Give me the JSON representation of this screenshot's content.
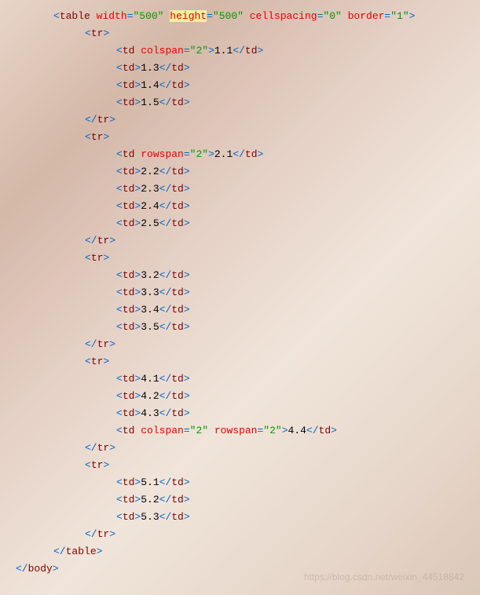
{
  "code": {
    "lines": [
      {
        "indent": 1,
        "parts": [
          {
            "type": "bracket",
            "text": "<"
          },
          {
            "type": "tagname",
            "text": "table"
          },
          {
            "type": "plain",
            "text": " "
          },
          {
            "type": "attrname",
            "text": "width"
          },
          {
            "type": "bracket",
            "text": "="
          },
          {
            "type": "attrvalue",
            "text": "\"500\""
          },
          {
            "type": "plain",
            "text": " "
          },
          {
            "type": "attrname",
            "text": "height",
            "highlight": true
          },
          {
            "type": "bracket",
            "text": "="
          },
          {
            "type": "attrvalue",
            "text": "\"500\""
          },
          {
            "type": "plain",
            "text": " "
          },
          {
            "type": "attrname",
            "text": "cellspacing"
          },
          {
            "type": "bracket",
            "text": "="
          },
          {
            "type": "attrvalue",
            "text": "\"0\""
          },
          {
            "type": "plain",
            "text": " "
          },
          {
            "type": "attrname",
            "text": "border"
          },
          {
            "type": "bracket",
            "text": "="
          },
          {
            "type": "attrvalue",
            "text": "\"1\""
          },
          {
            "type": "bracket",
            "text": ">"
          }
        ]
      },
      {
        "indent": 2,
        "parts": [
          {
            "type": "bracket",
            "text": "<"
          },
          {
            "type": "tagname",
            "text": "tr"
          },
          {
            "type": "bracket",
            "text": ">"
          }
        ]
      },
      {
        "indent": 3,
        "parts": [
          {
            "type": "bracket",
            "text": "<"
          },
          {
            "type": "tagname",
            "text": "td"
          },
          {
            "type": "plain",
            "text": " "
          },
          {
            "type": "attrname",
            "text": "colspan"
          },
          {
            "type": "bracket",
            "text": "="
          },
          {
            "type": "attrvalue",
            "text": "\"2\""
          },
          {
            "type": "bracket",
            "text": ">"
          },
          {
            "type": "content",
            "text": "1.1"
          },
          {
            "type": "bracket",
            "text": "</"
          },
          {
            "type": "tagname",
            "text": "td"
          },
          {
            "type": "bracket",
            "text": ">"
          }
        ]
      },
      {
        "indent": 3,
        "parts": [
          {
            "type": "bracket",
            "text": "<"
          },
          {
            "type": "tagname",
            "text": "td"
          },
          {
            "type": "bracket",
            "text": ">"
          },
          {
            "type": "content",
            "text": "1.3"
          },
          {
            "type": "bracket",
            "text": "</"
          },
          {
            "type": "tagname",
            "text": "td"
          },
          {
            "type": "bracket",
            "text": ">"
          }
        ]
      },
      {
        "indent": 3,
        "parts": [
          {
            "type": "bracket",
            "text": "<"
          },
          {
            "type": "tagname",
            "text": "td"
          },
          {
            "type": "bracket",
            "text": ">"
          },
          {
            "type": "content",
            "text": "1.4"
          },
          {
            "type": "bracket",
            "text": "</"
          },
          {
            "type": "tagname",
            "text": "td"
          },
          {
            "type": "bracket",
            "text": ">"
          }
        ]
      },
      {
        "indent": 3,
        "parts": [
          {
            "type": "bracket",
            "text": "<"
          },
          {
            "type": "tagname",
            "text": "td"
          },
          {
            "type": "bracket",
            "text": ">"
          },
          {
            "type": "content",
            "text": "1.5"
          },
          {
            "type": "bracket",
            "text": "</"
          },
          {
            "type": "tagname",
            "text": "td"
          },
          {
            "type": "bracket",
            "text": ">"
          }
        ]
      },
      {
        "indent": 2,
        "parts": [
          {
            "type": "bracket",
            "text": "</"
          },
          {
            "type": "tagname",
            "text": "tr"
          },
          {
            "type": "bracket",
            "text": ">"
          }
        ]
      },
      {
        "indent": 2,
        "parts": [
          {
            "type": "bracket",
            "text": "<"
          },
          {
            "type": "tagname",
            "text": "tr"
          },
          {
            "type": "bracket",
            "text": ">"
          }
        ]
      },
      {
        "indent": 3,
        "parts": [
          {
            "type": "bracket",
            "text": "<"
          },
          {
            "type": "tagname",
            "text": "td"
          },
          {
            "type": "plain",
            "text": " "
          },
          {
            "type": "attrname",
            "text": "rowspan"
          },
          {
            "type": "bracket",
            "text": "="
          },
          {
            "type": "attrvalue",
            "text": "\"2\""
          },
          {
            "type": "bracket",
            "text": ">"
          },
          {
            "type": "content",
            "text": "2.1"
          },
          {
            "type": "bracket",
            "text": "</"
          },
          {
            "type": "tagname",
            "text": "td"
          },
          {
            "type": "bracket",
            "text": ">"
          }
        ]
      },
      {
        "indent": 3,
        "parts": [
          {
            "type": "bracket",
            "text": "<"
          },
          {
            "type": "tagname",
            "text": "td"
          },
          {
            "type": "bracket",
            "text": ">"
          },
          {
            "type": "content",
            "text": "2.2"
          },
          {
            "type": "bracket",
            "text": "</"
          },
          {
            "type": "tagname",
            "text": "td"
          },
          {
            "type": "bracket",
            "text": ">"
          }
        ]
      },
      {
        "indent": 3,
        "parts": [
          {
            "type": "bracket",
            "text": "<"
          },
          {
            "type": "tagname",
            "text": "td"
          },
          {
            "type": "bracket",
            "text": ">"
          },
          {
            "type": "content",
            "text": "2.3"
          },
          {
            "type": "bracket",
            "text": "</"
          },
          {
            "type": "tagname",
            "text": "td"
          },
          {
            "type": "bracket",
            "text": ">"
          }
        ]
      },
      {
        "indent": 3,
        "parts": [
          {
            "type": "bracket",
            "text": "<"
          },
          {
            "type": "tagname",
            "text": "td"
          },
          {
            "type": "bracket",
            "text": ">"
          },
          {
            "type": "content",
            "text": "2.4"
          },
          {
            "type": "bracket",
            "text": "</"
          },
          {
            "type": "tagname",
            "text": "td"
          },
          {
            "type": "bracket",
            "text": ">"
          }
        ]
      },
      {
        "indent": 3,
        "parts": [
          {
            "type": "bracket",
            "text": "<"
          },
          {
            "type": "tagname",
            "text": "td"
          },
          {
            "type": "bracket",
            "text": ">"
          },
          {
            "type": "content",
            "text": "2.5"
          },
          {
            "type": "bracket",
            "text": "</"
          },
          {
            "type": "tagname",
            "text": "td"
          },
          {
            "type": "bracket",
            "text": ">"
          }
        ]
      },
      {
        "indent": 2,
        "parts": [
          {
            "type": "bracket",
            "text": "</"
          },
          {
            "type": "tagname",
            "text": "tr"
          },
          {
            "type": "bracket",
            "text": ">"
          }
        ]
      },
      {
        "indent": 2,
        "parts": [
          {
            "type": "bracket",
            "text": "<"
          },
          {
            "type": "tagname",
            "text": "tr"
          },
          {
            "type": "bracket",
            "text": ">"
          }
        ]
      },
      {
        "indent": 3,
        "parts": [
          {
            "type": "bracket",
            "text": "<"
          },
          {
            "type": "tagname",
            "text": "td"
          },
          {
            "type": "bracket",
            "text": ">"
          },
          {
            "type": "content",
            "text": "3.2"
          },
          {
            "type": "bracket",
            "text": "</"
          },
          {
            "type": "tagname",
            "text": "td"
          },
          {
            "type": "bracket",
            "text": ">"
          }
        ]
      },
      {
        "indent": 3,
        "parts": [
          {
            "type": "bracket",
            "text": "<"
          },
          {
            "type": "tagname",
            "text": "td"
          },
          {
            "type": "bracket",
            "text": ">"
          },
          {
            "type": "content",
            "text": "3.3"
          },
          {
            "type": "bracket",
            "text": "</"
          },
          {
            "type": "tagname",
            "text": "td"
          },
          {
            "type": "bracket",
            "text": ">"
          }
        ]
      },
      {
        "indent": 3,
        "parts": [
          {
            "type": "bracket",
            "text": "<"
          },
          {
            "type": "tagname",
            "text": "td"
          },
          {
            "type": "bracket",
            "text": ">"
          },
          {
            "type": "content",
            "text": "3.4"
          },
          {
            "type": "bracket",
            "text": "</"
          },
          {
            "type": "tagname",
            "text": "td"
          },
          {
            "type": "bracket",
            "text": ">"
          }
        ]
      },
      {
        "indent": 3,
        "parts": [
          {
            "type": "bracket",
            "text": "<"
          },
          {
            "type": "tagname",
            "text": "td"
          },
          {
            "type": "bracket",
            "text": ">"
          },
          {
            "type": "content",
            "text": "3.5"
          },
          {
            "type": "bracket",
            "text": "</"
          },
          {
            "type": "tagname",
            "text": "td"
          },
          {
            "type": "bracket",
            "text": ">"
          }
        ]
      },
      {
        "indent": 2,
        "parts": [
          {
            "type": "bracket",
            "text": "</"
          },
          {
            "type": "tagname",
            "text": "tr"
          },
          {
            "type": "bracket",
            "text": ">"
          }
        ]
      },
      {
        "indent": 2,
        "parts": [
          {
            "type": "bracket",
            "text": "<"
          },
          {
            "type": "tagname",
            "text": "tr"
          },
          {
            "type": "bracket",
            "text": ">"
          }
        ]
      },
      {
        "indent": 3,
        "parts": [
          {
            "type": "bracket",
            "text": "<"
          },
          {
            "type": "tagname",
            "text": "td"
          },
          {
            "type": "bracket",
            "text": ">"
          },
          {
            "type": "content",
            "text": "4.1"
          },
          {
            "type": "bracket",
            "text": "</"
          },
          {
            "type": "tagname",
            "text": "td"
          },
          {
            "type": "bracket",
            "text": ">"
          }
        ]
      },
      {
        "indent": 3,
        "parts": [
          {
            "type": "bracket",
            "text": "<"
          },
          {
            "type": "tagname",
            "text": "td"
          },
          {
            "type": "bracket",
            "text": ">"
          },
          {
            "type": "content",
            "text": "4.2"
          },
          {
            "type": "bracket",
            "text": "</"
          },
          {
            "type": "tagname",
            "text": "td"
          },
          {
            "type": "bracket",
            "text": ">"
          }
        ]
      },
      {
        "indent": 3,
        "parts": [
          {
            "type": "bracket",
            "text": "<"
          },
          {
            "type": "tagname",
            "text": "td"
          },
          {
            "type": "bracket",
            "text": ">"
          },
          {
            "type": "content",
            "text": "4.3"
          },
          {
            "type": "bracket",
            "text": "</"
          },
          {
            "type": "tagname",
            "text": "td"
          },
          {
            "type": "bracket",
            "text": ">"
          }
        ]
      },
      {
        "indent": 3,
        "parts": [
          {
            "type": "bracket",
            "text": "<"
          },
          {
            "type": "tagname",
            "text": "td"
          },
          {
            "type": "plain",
            "text": " "
          },
          {
            "type": "attrname",
            "text": "colspan"
          },
          {
            "type": "bracket",
            "text": "="
          },
          {
            "type": "attrvalue",
            "text": "\"2\""
          },
          {
            "type": "plain",
            "text": " "
          },
          {
            "type": "attrname",
            "text": "rowspan"
          },
          {
            "type": "bracket",
            "text": "="
          },
          {
            "type": "attrvalue",
            "text": "\"2\""
          },
          {
            "type": "bracket",
            "text": ">"
          },
          {
            "type": "content",
            "text": "4.4"
          },
          {
            "type": "bracket",
            "text": "</"
          },
          {
            "type": "tagname",
            "text": "td"
          },
          {
            "type": "bracket",
            "text": ">"
          }
        ]
      },
      {
        "indent": 2,
        "parts": [
          {
            "type": "bracket",
            "text": "</"
          },
          {
            "type": "tagname",
            "text": "tr"
          },
          {
            "type": "bracket",
            "text": ">"
          }
        ]
      },
      {
        "indent": 2,
        "parts": [
          {
            "type": "bracket",
            "text": "<"
          },
          {
            "type": "tagname",
            "text": "tr"
          },
          {
            "type": "bracket",
            "text": ">"
          }
        ]
      },
      {
        "indent": 3,
        "parts": [
          {
            "type": "bracket",
            "text": "<"
          },
          {
            "type": "tagname",
            "text": "td"
          },
          {
            "type": "bracket",
            "text": ">"
          },
          {
            "type": "content",
            "text": "5.1"
          },
          {
            "type": "bracket",
            "text": "</"
          },
          {
            "type": "tagname",
            "text": "td"
          },
          {
            "type": "bracket",
            "text": ">"
          }
        ]
      },
      {
        "indent": 3,
        "parts": [
          {
            "type": "bracket",
            "text": "<"
          },
          {
            "type": "tagname",
            "text": "td"
          },
          {
            "type": "bracket",
            "text": ">"
          },
          {
            "type": "content",
            "text": "5.2"
          },
          {
            "type": "bracket",
            "text": "</"
          },
          {
            "type": "tagname",
            "text": "td"
          },
          {
            "type": "bracket",
            "text": ">"
          }
        ]
      },
      {
        "indent": 3,
        "parts": [
          {
            "type": "bracket",
            "text": "<"
          },
          {
            "type": "tagname",
            "text": "td"
          },
          {
            "type": "bracket",
            "text": ">"
          },
          {
            "type": "content",
            "text": "5.3"
          },
          {
            "type": "bracket",
            "text": "</"
          },
          {
            "type": "tagname",
            "text": "td"
          },
          {
            "type": "bracket",
            "text": ">"
          }
        ]
      },
      {
        "indent": 2,
        "parts": [
          {
            "type": "bracket",
            "text": "</"
          },
          {
            "type": "tagname",
            "text": "tr"
          },
          {
            "type": "bracket",
            "text": ">"
          }
        ]
      },
      {
        "indent": 1,
        "parts": [
          {
            "type": "bracket",
            "text": "</"
          },
          {
            "type": "tagname",
            "text": "table"
          },
          {
            "type": "bracket",
            "text": ">"
          }
        ]
      },
      {
        "indent": 0,
        "parts": [
          {
            "type": "bracket",
            "text": "</"
          },
          {
            "type": "tagname",
            "text": "body"
          },
          {
            "type": "bracket",
            "text": ">"
          }
        ]
      }
    ]
  },
  "watermark": "https://blog.csdn.net/weixin_44518842"
}
